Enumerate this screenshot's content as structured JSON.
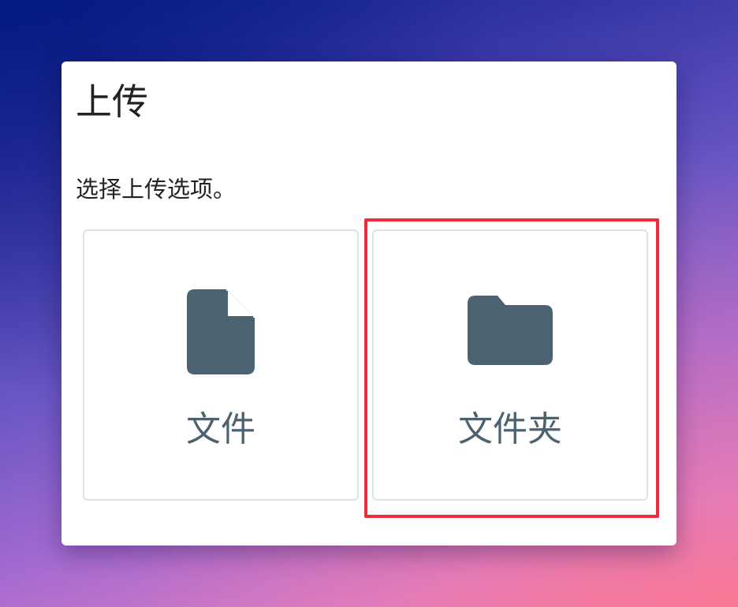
{
  "dialog": {
    "title": "上传",
    "subtitle": "选择上传选项。",
    "options": [
      {
        "label": "文件",
        "icon": "file-icon"
      },
      {
        "label": "文件夹",
        "icon": "folder-icon"
      }
    ]
  },
  "colors": {
    "icon": "#4b6270",
    "highlight": "#ee2d3c",
    "card_border": "#e2e2e2"
  }
}
